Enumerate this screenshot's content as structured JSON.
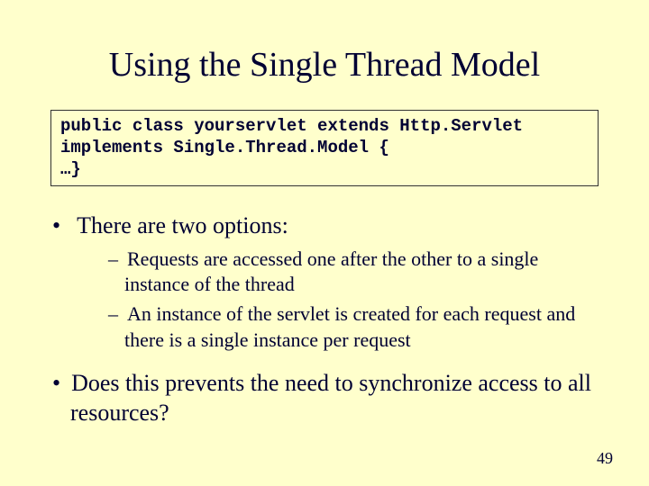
{
  "title": "Using the Single Thread Model",
  "code": "public class yourservlet extends Http.Servlet implements Single.Thread.Model {\n…}",
  "bullets": {
    "b1": "There are two options:",
    "sub1": "Requests are accessed one after the other to a single instance of the thread",
    "sub2": "An instance of the servlet is created for each request and there is a single instance per request",
    "b2": "Does this prevents the need to synchronize access to all resources?"
  },
  "pagenum": "49"
}
